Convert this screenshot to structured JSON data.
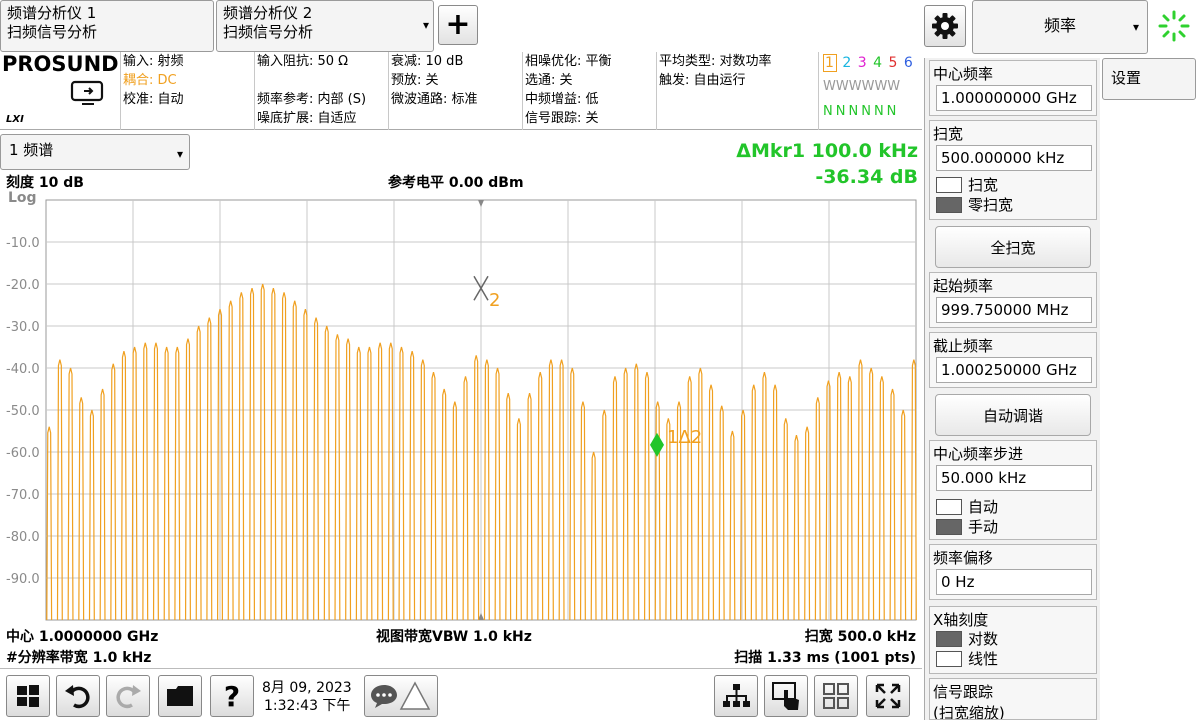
{
  "tabs": [
    {
      "line1": "频谱分析仪 1",
      "line2": "扫频信号分析"
    },
    {
      "line1": "频谱分析仪 2",
      "line2": "扫频信号分析"
    }
  ],
  "add_tab_symbol": "+",
  "top_menu": {
    "label": "频率",
    "caret": "▾"
  },
  "side_button": {
    "label": "设置"
  },
  "brand": {
    "name": "PROSUND",
    "lxi": "LXI"
  },
  "info": {
    "col1": [
      "输入: 射频",
      "耦合: DC",
      "校准: 自动"
    ],
    "col2": [
      "输入阻抗: 50 Ω",
      "",
      "频率参考: 内部 (S)",
      "噪底扩展: 自适应"
    ],
    "col3": [
      "衰减: 10 dB",
      "预放: 关",
      "微波通路: 标准"
    ],
    "col4": [
      "相噪优化: 平衡",
      "选通: 关",
      "中频增益: 低",
      "信号跟踪: 关"
    ],
    "col5": [
      "平均类型: 对数功率",
      "触发: 自由运行"
    ],
    "trace_nums": [
      "1",
      "2",
      "3",
      "4",
      "5",
      "6"
    ],
    "trace_types": [
      "W",
      "W",
      "W",
      "W",
      "W",
      "W"
    ],
    "trace_det": [
      "N",
      "N",
      "N",
      "N",
      "N",
      "N"
    ]
  },
  "colors": {
    "coupling": "#f0a020",
    "trace": "#f0a020",
    "marker": "#22c52a",
    "delta": "#22c52a",
    "grid": "#c8c8c8",
    "trace_num_colors": [
      "#f0a020",
      "#19b5e0",
      "#e020d0",
      "#22c52a",
      "#e03030",
      "#3060e0"
    ]
  },
  "window_select": {
    "label": "1 频谱",
    "caret": "▾"
  },
  "graph": {
    "scale": "刻度 10 dB",
    "log": "Log",
    "ref_level": "参考电平 0.00 dBm",
    "delta_mkr_line1": "ΔMkr1  100.0 kHz",
    "delta_mkr_line2": "-36.34 dB",
    "center": "中心 1.0000000 GHz",
    "vbw": "视图带宽VBW 1.0 kHz",
    "span": "扫宽 500.0 kHz",
    "rbw": "#分辨率带宽 1.0 kHz",
    "sweep": "扫描 1.33 ms (1001 pts)",
    "marker2_label": "2",
    "marker1_label": "1Δ2"
  },
  "chart_data": {
    "type": "line",
    "ylim": [
      -100,
      0
    ],
    "yticks": [
      "-10.0",
      "-20.0",
      "-30.0",
      "-40.0",
      "-50.0",
      "-60.0",
      "-70.0",
      "-80.0",
      "-90.0"
    ],
    "xlim_khz": [
      -250,
      250
    ],
    "spectral_line_spacing_khz": 5,
    "peak_levels_dbm": [
      -54,
      -38,
      -40,
      -47,
      -50,
      -45,
      -39,
      -36,
      -35,
      -34,
      -34,
      -35,
      -35,
      -33,
      -30,
      -28,
      -26,
      -24,
      -22,
      -21,
      -20,
      -21,
      -22,
      -24,
      -26,
      -28,
      -30,
      -32,
      -33,
      -35,
      -35,
      -34,
      -34,
      -35,
      -36,
      -38,
      -41,
      -45,
      -48,
      -42,
      -37,
      -38,
      -40,
      -46,
      -52,
      -46,
      -41,
      -38,
      -38,
      -40,
      -48,
      -60,
      -50,
      -42,
      -40,
      -39,
      -41,
      -48,
      -52,
      -48,
      -42,
      -40,
      -44,
      -49,
      -55,
      -50,
      -44,
      -41,
      -44,
      -52,
      -56,
      -54,
      -47,
      -43,
      -41,
      -42,
      -38,
      -40,
      -42,
      -45,
      -50,
      -38
    ],
    "floor_dbm": -100,
    "markers": [
      {
        "name": "2",
        "x_khz": 0,
        "level_dbm": -21
      },
      {
        "name": "1Δ2",
        "x_khz": 100,
        "delta_db": -36.34
      }
    ]
  },
  "right_panel": {
    "center_freq": {
      "title": "中心频率",
      "value": "1.000000000 GHz"
    },
    "span": {
      "title": "扫宽",
      "value": "500.000000 kHz",
      "opt1": "扫宽",
      "opt2": "零扫宽"
    },
    "full_span": "全扫宽",
    "start_freq": {
      "title": "起始频率",
      "value": "999.750000 MHz"
    },
    "stop_freq": {
      "title": "截止频率",
      "value": "1.000250000 GHz"
    },
    "auto_tune": "自动调谐",
    "cf_step": {
      "title": "中心频率步进",
      "value": "50.000 kHz",
      "opt1": "自动",
      "opt2": "手动"
    },
    "freq_offset": {
      "title": "频率偏移",
      "value": "0 Hz"
    },
    "x_scale": {
      "title": "X轴刻度",
      "opt1": "对数",
      "opt2": "线性"
    },
    "signal_track": {
      "title": "信号跟踪",
      "sub": "(扫宽缩放)"
    }
  },
  "datetime": {
    "date": "8月 09, 2023",
    "time": "1:32:43 下午"
  }
}
